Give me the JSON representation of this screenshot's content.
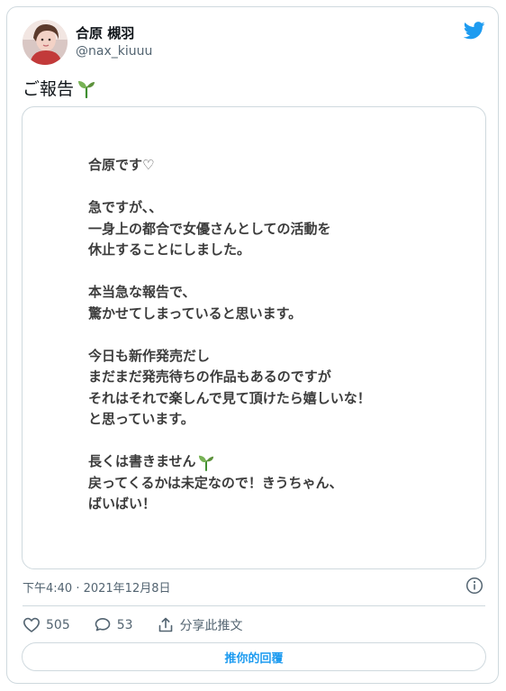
{
  "colors": {
    "accent": "#1d9bf0",
    "muted": "#536471",
    "border": "#cfd9de",
    "text": "#0f1419"
  },
  "author": {
    "display_name": "合原 槻羽",
    "handle": "@nax_kiuuu",
    "avatar": "avatar-photo"
  },
  "brand_icon": "twitter-bird-icon",
  "tweet": {
    "text": "ご報告",
    "emoji": "seedling-icon"
  },
  "image_text": {
    "lines": [
      "合原です♡",
      "",
      "急ですが、、",
      "一身上の都合で女優さんとしての活動を",
      "休止することにしました。",
      "",
      "本当急な報告で、",
      "驚かせてしまっていると思います。",
      "",
      "今日も新作発売だし",
      "まだまだ発売待ちの作品もあるのですが",
      "それはそれで楽しんで見て頂けたら嬉しいな！",
      "と思っています。",
      "",
      "長くは書きません",
      "戻ってくるかは未定なので！きうちゃん、",
      "ばいばい！"
    ]
  },
  "meta": {
    "timestamp": "下午4:40 · 2021年12月8日"
  },
  "actions": {
    "likes": "505",
    "replies": "53",
    "share_label": "分享此推文"
  },
  "reply_button": {
    "label": "推你的回覆"
  }
}
